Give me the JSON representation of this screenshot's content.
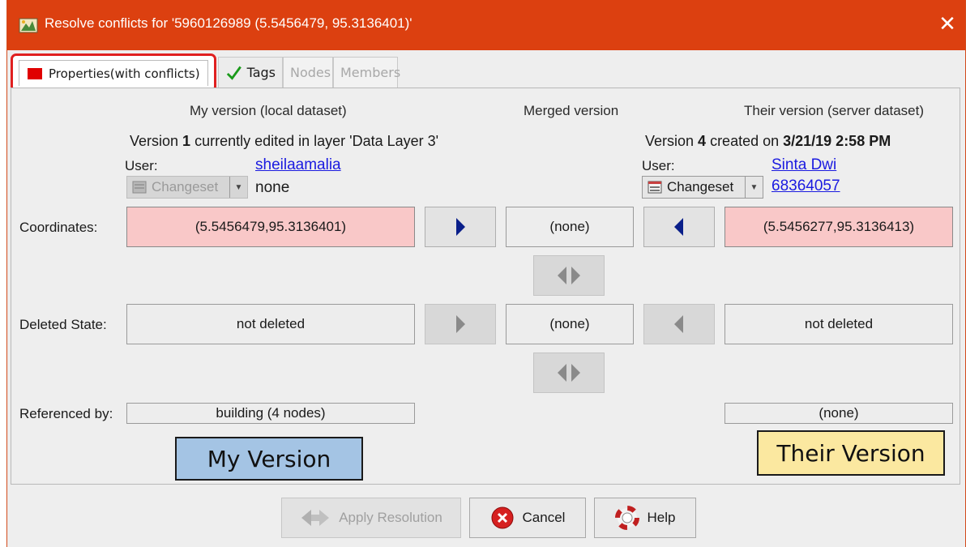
{
  "window": {
    "title": "Resolve conflicts for '5960126989 (5.5456479, 95.3136401)'",
    "close_glyph": "✕",
    "accent": "#dc4010"
  },
  "tabs": [
    {
      "label": "Properties(with conflicts)",
      "icon": "red-square-icon",
      "active": true
    },
    {
      "label": "Tags",
      "icon": "checkmark-icon",
      "active": false
    },
    {
      "label": "Nodes",
      "enabled": false
    },
    {
      "label": "Members",
      "enabled": false
    }
  ],
  "columns": {
    "mine": "My version (local dataset)",
    "merged": "Merged version",
    "theirs": "Their version (server dataset)"
  },
  "mine": {
    "version_prefix": "Version ",
    "version_number": "1",
    "version_suffix": " currently edited in layer 'Data Layer 3'",
    "user_label": "User:",
    "user": "sheilaamalia",
    "changeset_label": "Changeset",
    "changeset_value": "none"
  },
  "theirs": {
    "version_prefix": "Version ",
    "version_number": "4",
    "version_mid": " created on ",
    "version_date": "3/21/19 2:58 PM",
    "user_label": "User:",
    "user": "Sinta Dwi",
    "changeset_label": "Changeset",
    "changeset_value": "68364057"
  },
  "rows": {
    "coordinates": {
      "label": "Coordinates:",
      "mine": "(5.5456479,95.3136401)",
      "merged": "(none)",
      "theirs": "(5.5456277,95.3136413)"
    },
    "deleted_state": {
      "label": "Deleted State:",
      "mine": "not deleted",
      "merged": "(none)",
      "theirs": "not deleted"
    },
    "referenced_by": {
      "label": "Referenced by:",
      "mine": "building (4 nodes)",
      "theirs": "(none)"
    }
  },
  "annotations": {
    "my_version": "My Version",
    "their_version": "Their Version",
    "my_color": "#a4c4e4",
    "their_color": "#fbe8a0"
  },
  "buttons": {
    "apply": "Apply Resolution",
    "cancel": "Cancel",
    "help": "Help"
  }
}
